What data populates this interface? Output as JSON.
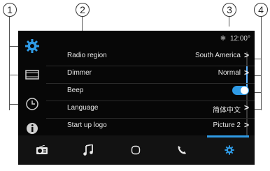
{
  "callouts": [
    "1",
    "2",
    "3",
    "4"
  ],
  "status": {
    "time": "12:00",
    "temperature_unit": "°",
    "bluetooth_icon": "bluetooth-icon"
  },
  "sidebar": [
    {
      "icon": "gear-icon",
      "active": true
    },
    {
      "icon": "film-icon",
      "active": false
    },
    {
      "icon": "clock-icon",
      "active": false
    },
    {
      "icon": "info-icon",
      "active": false
    }
  ],
  "settings": [
    {
      "label": "Radio region",
      "value": "South America"
    },
    {
      "label": "Dimmer",
      "value": "Normal"
    },
    {
      "label": "Beep",
      "value": "",
      "toggle": true,
      "toggle_on": true
    },
    {
      "label": "Language",
      "value": "简体中文"
    },
    {
      "label": "Start up logo",
      "value": "Picture 2"
    }
  ],
  "bottom_bar": [
    {
      "icon": "radio-icon"
    },
    {
      "icon": "music-note-icon"
    },
    {
      "icon": "home-circle-icon"
    },
    {
      "icon": "phone-icon"
    },
    {
      "icon": "gear-icon",
      "active": true
    }
  ],
  "colors": {
    "accent": "#2f9be6",
    "screen_bg": "#070707",
    "text": "#e8e8e8"
  }
}
